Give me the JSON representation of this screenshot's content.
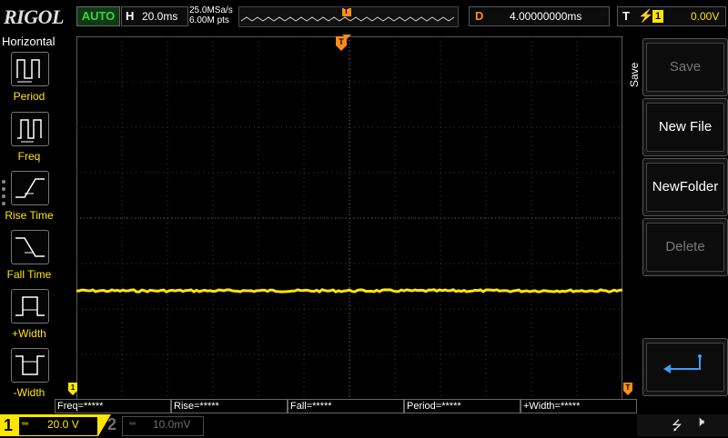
{
  "header": {
    "brand": "RIGOL",
    "run_mode": "AUTO",
    "timebase_label": "H",
    "timebase_value": "20.0ms",
    "sample_rate": "25.0MSa/s",
    "memory_depth": "6.00M pts",
    "trigger_marker": "T",
    "delay_label": "D",
    "delay_value": "4.00000000ms",
    "trigger_label": "T",
    "trigger_source": "1",
    "trigger_level": "0.00V"
  },
  "measure_panel": {
    "title": "Horizontal",
    "items": [
      {
        "label": "Period",
        "icon": "period-icon"
      },
      {
        "label": "Freq",
        "icon": "frequency-icon"
      },
      {
        "label": "Rise Time",
        "icon": "rise-time-icon"
      },
      {
        "label": "Fall Time",
        "icon": "fall-time-icon"
      },
      {
        "label": "+Width",
        "icon": "positive-width-icon"
      },
      {
        "label": "-Width",
        "icon": "negative-width-icon"
      }
    ]
  },
  "measurements": [
    "Freq=*****",
    "Rise=*****",
    "Fall=*****",
    "Period=*****",
    "+Width=*****"
  ],
  "softkeys": {
    "menu_title": "Save",
    "save": "Save",
    "new_file": "New File",
    "new_folder": "NewFolder",
    "delete": "Delete",
    "back_icon": "return-arrow-icon"
  },
  "channels": {
    "ch1_number": "1",
    "ch1_scale": "20.0 V",
    "ch2_number": "2",
    "ch2_scale": "10.0mV"
  },
  "waveform": {
    "channel": "1",
    "trace_level_divisions": -1.6,
    "color": "#ffe600"
  },
  "colors": {
    "ch1": "#ffe600",
    "trigger": "#ff8c1a",
    "run_auto": "#3cd43c"
  }
}
